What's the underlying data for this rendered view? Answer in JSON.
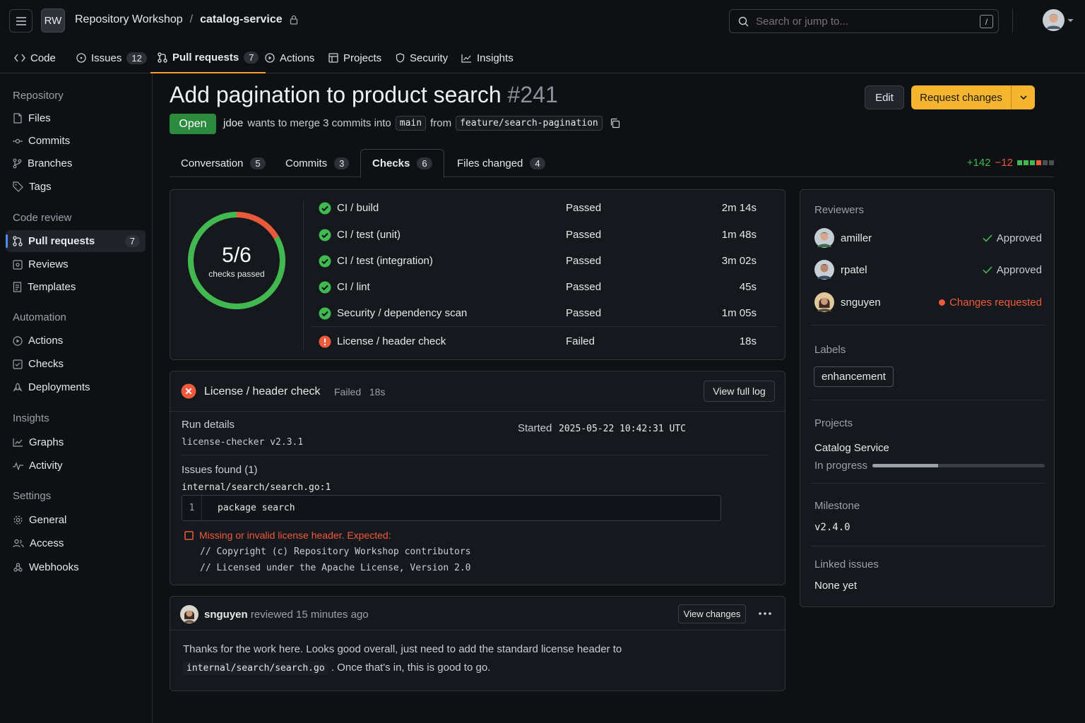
{
  "header": {
    "org_initials": "RW",
    "org_name": "Repository Workshop",
    "separator": "/",
    "repo_name": "catalog-service",
    "search_placeholder": "Search or jump to...",
    "search_shortcut": "/"
  },
  "repo_nav": {
    "code": "Code",
    "issues": "Issues",
    "issues_count": "12",
    "pulls": "Pull requests",
    "pulls_count": "7",
    "actions": "Actions",
    "projects": "Projects",
    "security": "Security",
    "insights": "Insights"
  },
  "sidebar": {
    "repository": "Repository",
    "files": "Files",
    "commits": "Commits",
    "branches": "Branches",
    "tags": "Tags",
    "code_review": "Code review",
    "pull_requests": "Pull requests",
    "pull_requests_count": "7",
    "reviews": "Reviews",
    "templates": "Templates",
    "automation": "Automation",
    "actions": "Actions",
    "checks": "Checks",
    "deployments": "Deployments",
    "insights": "Insights",
    "graphs": "Graphs",
    "activity": "Activity",
    "settings": "Settings",
    "general": "General",
    "access": "Access",
    "webhooks": "Webhooks"
  },
  "pr": {
    "title": "Add pagination to product search",
    "number": "#241",
    "edit_label": "Edit",
    "request_changes_label": "Request changes",
    "state": "Open",
    "author": "jdoe",
    "merge_text": "wants to merge 3 commits into",
    "base_branch": "main",
    "from_text": "from",
    "head_branch": "feature/search-pagination"
  },
  "pr_tabs": {
    "conversation": "Conversation",
    "conversation_count": "5",
    "commits": "Commits",
    "commits_count": "3",
    "checks": "Checks",
    "checks_count": "6",
    "files": "Files changed",
    "files_count": "4",
    "additions": "+142",
    "deletions": "−12"
  },
  "checks_summary": {
    "ratio": "5/6",
    "caption": "checks passed",
    "passed": 5,
    "total": 6,
    "rows": [
      {
        "name": "CI / build",
        "status": "Passed",
        "duration": "2m 14s"
      },
      {
        "name": "CI / test (unit)",
        "status": "Passed",
        "duration": "1m 48s"
      },
      {
        "name": "CI / test (integration)",
        "status": "Passed",
        "duration": "3m 02s"
      },
      {
        "name": "CI / lint",
        "status": "Passed",
        "duration": "45s"
      },
      {
        "name": "Security / dependency scan",
        "status": "Passed",
        "duration": "1m 05s"
      },
      {
        "name": "License / header check",
        "status": "Failed",
        "duration": "18s"
      }
    ]
  },
  "failure": {
    "title": "License / header check",
    "status": "Failed",
    "duration": "18s",
    "view_log": "View full log",
    "run_details_label": "Run details",
    "tool": "license-checker v2.3.1",
    "started_label": "Started",
    "started_value": "2025-05-22 10:42:31 UTC",
    "issues_label": "Issues found (1)",
    "file_ref": "internal/search/search.go:1",
    "line_no": "1",
    "code_line": "package search",
    "error_msg": "Missing or invalid license header. Expected:",
    "expected_1": "// Copyright (c) Repository Workshop contributors",
    "expected_2": "// Licensed under the Apache License, Version 2.0"
  },
  "review": {
    "user": "snguyen",
    "action": "reviewed 15 minutes ago",
    "view_changes": "View changes",
    "body_1": "Thanks for the work here. Looks good overall, just need to add the standard license header to",
    "body_code": "internal/search/search.go",
    "body_2": ". Once that's in, this is good to go."
  },
  "right": {
    "reviewers_label": "Reviewers",
    "reviewers": [
      {
        "name": "amiller",
        "status": "Approved"
      },
      {
        "name": "rpatel",
        "status": "Approved"
      },
      {
        "name": "snguyen",
        "status": "Changes requested"
      }
    ],
    "labels_label": "Labels",
    "label": "enhancement",
    "projects_label": "Projects",
    "project_name": "Catalog Service",
    "project_status": "In progress",
    "project_progress": 0.38,
    "milestone_label": "Milestone",
    "milestone": "v2.4.0",
    "linked_label": "Linked issues",
    "linked_value": "None yet"
  },
  "colors": {
    "accent": "#f6b52f",
    "success": "#3fb950",
    "danger": "#f05a3c",
    "open_badge": "#2b8a3e"
  }
}
